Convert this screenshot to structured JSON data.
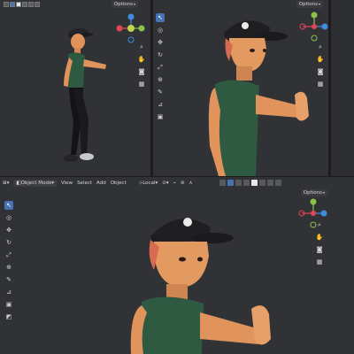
{
  "top_left_viewport": {
    "options_label": "Options"
  },
  "top_right_viewport": {
    "options_label": "Options"
  },
  "bottom_viewport": {
    "options_label": "Options"
  },
  "header": {
    "mode": "Object Mode",
    "menus": [
      "View",
      "Select",
      "Add",
      "Object"
    ],
    "transform_orientation": "Local"
  },
  "gizmo_axes": {
    "x": "X",
    "y": "Y",
    "z": "Z"
  },
  "colors": {
    "accent": "#4772b3",
    "x_axis": "#e0455a",
    "y_axis": "#8bc34a",
    "z_axis": "#3f8ce0",
    "viewport_bg": "#303236"
  },
  "toolbar_icons": [
    "cursor-icon",
    "3d-cursor-icon",
    "move-icon",
    "rotate-icon",
    "scale-icon",
    "transform-icon",
    "annotate-icon",
    "measure-icon",
    "add-cube-icon"
  ],
  "nav_icons": [
    "zoom-icon",
    "pan-hand-icon",
    "camera-icon",
    "grid-icon"
  ]
}
